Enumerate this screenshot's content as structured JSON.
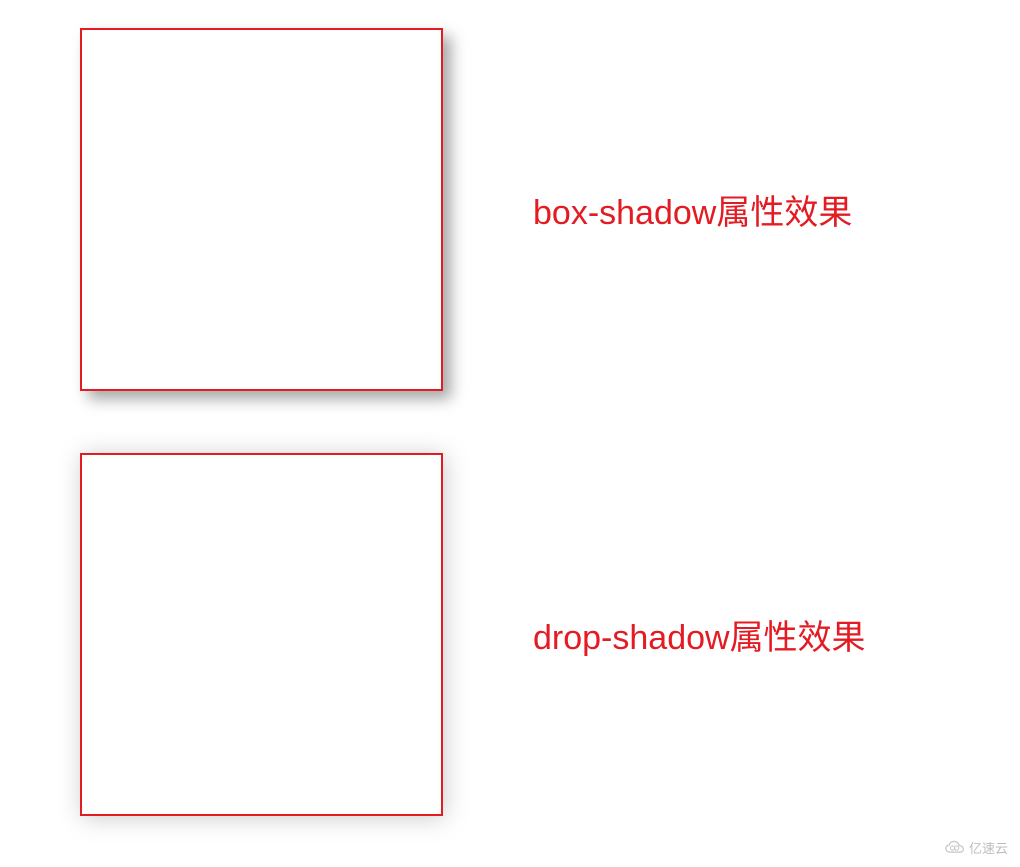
{
  "examples": [
    {
      "label": "box-shadow属性效果"
    },
    {
      "label": "drop-shadow属性效果"
    }
  ],
  "watermark": {
    "text": "亿速云"
  }
}
